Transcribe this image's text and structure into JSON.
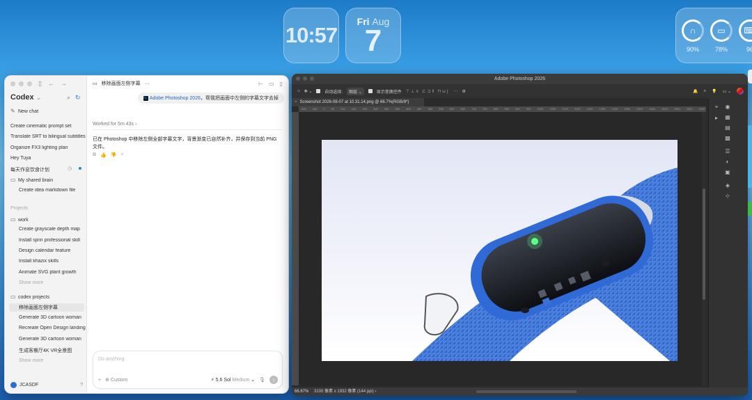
{
  "widgets": {
    "clock": "10:57",
    "date_dow": "Fri",
    "date_month": "Aug",
    "date_day": "7",
    "battery": [
      {
        "icon": "airpods-icon",
        "glyph": "∩",
        "pct": "90%"
      },
      {
        "icon": "case-icon",
        "glyph": "▭",
        "pct": "78%"
      },
      {
        "icon": "keyboard-icon",
        "glyph": "⌨",
        "pct": "96"
      }
    ]
  },
  "codex": {
    "app_name": "Codex",
    "new_chat": "New chat",
    "chats": [
      "Create cinematic prompt set",
      "Translate SRT to bilingual subtitles",
      "Organize FX3 lighting plan",
      "Hey Tuya",
      "每天作息饮食计划"
    ],
    "shared_folder": "My shared brain",
    "shared_items": [
      "Create idea markdown file"
    ],
    "projects_label": "Projects",
    "project_work": "work",
    "work_items": [
      "Create grayscale depth map",
      "Install sjinn professional skill",
      "Design calendar feature",
      "Install khazix skills",
      "Animate SVG plant growth"
    ],
    "show_more": "Show more",
    "project_codex": "codex projects",
    "codex_items": [
      "移除画面左侧字幕",
      "Generate 3D cartoon woman",
      "Recreate Open Design landing",
      "Generate 3D cartoon woman",
      "生成客餐厅4K VR全景图"
    ],
    "user": "JCASDF",
    "chat_title": "移除画面左侧字幕",
    "user_msg_app": "Adobe Photoshop 2026",
    "user_msg_text": "，帮我把画面中左侧的字幕文字去掉",
    "worked": "Worked for 5m 43s",
    "reply": "已在 Photoshop 中移除左侧全部字幕文字，背景渐变已自然补齐，并保存到当前 PNG 文件。",
    "composer_placeholder": "Do anything",
    "composer_custom": "Custom",
    "composer_model": "5.6 Sol",
    "composer_effort": "Medium"
  },
  "photoshop": {
    "window_title": "Adobe Photoshop 2026",
    "auto_select_label": "自动选择:",
    "auto_select_value": "图层",
    "show_transform": "显示变换控件",
    "doc_tab": "Screenshot 2026-08-07 at 10.31.14.png @ 66.7%(RGB/8*)",
    "ruler_ticks": [
      "200",
      "150",
      "0",
      "50",
      "100",
      "150",
      "200",
      "250",
      "300",
      "350",
      "400",
      "450",
      "500",
      "550",
      "600",
      "650",
      "700",
      "750",
      "800",
      "850",
      "900",
      "950",
      "1000",
      "1050",
      "1100",
      "1150",
      "1200",
      "1250",
      "1300",
      "1350",
      "1400",
      "1450",
      "1500",
      "1550",
      "1600",
      "1650",
      "1700",
      "1750",
      "1800",
      "1850",
      "1900",
      "1950",
      "2000"
    ],
    "zoom": "66.67%",
    "doc_info": "3100 像素 x 1932 像素 (144 ppi)"
  }
}
